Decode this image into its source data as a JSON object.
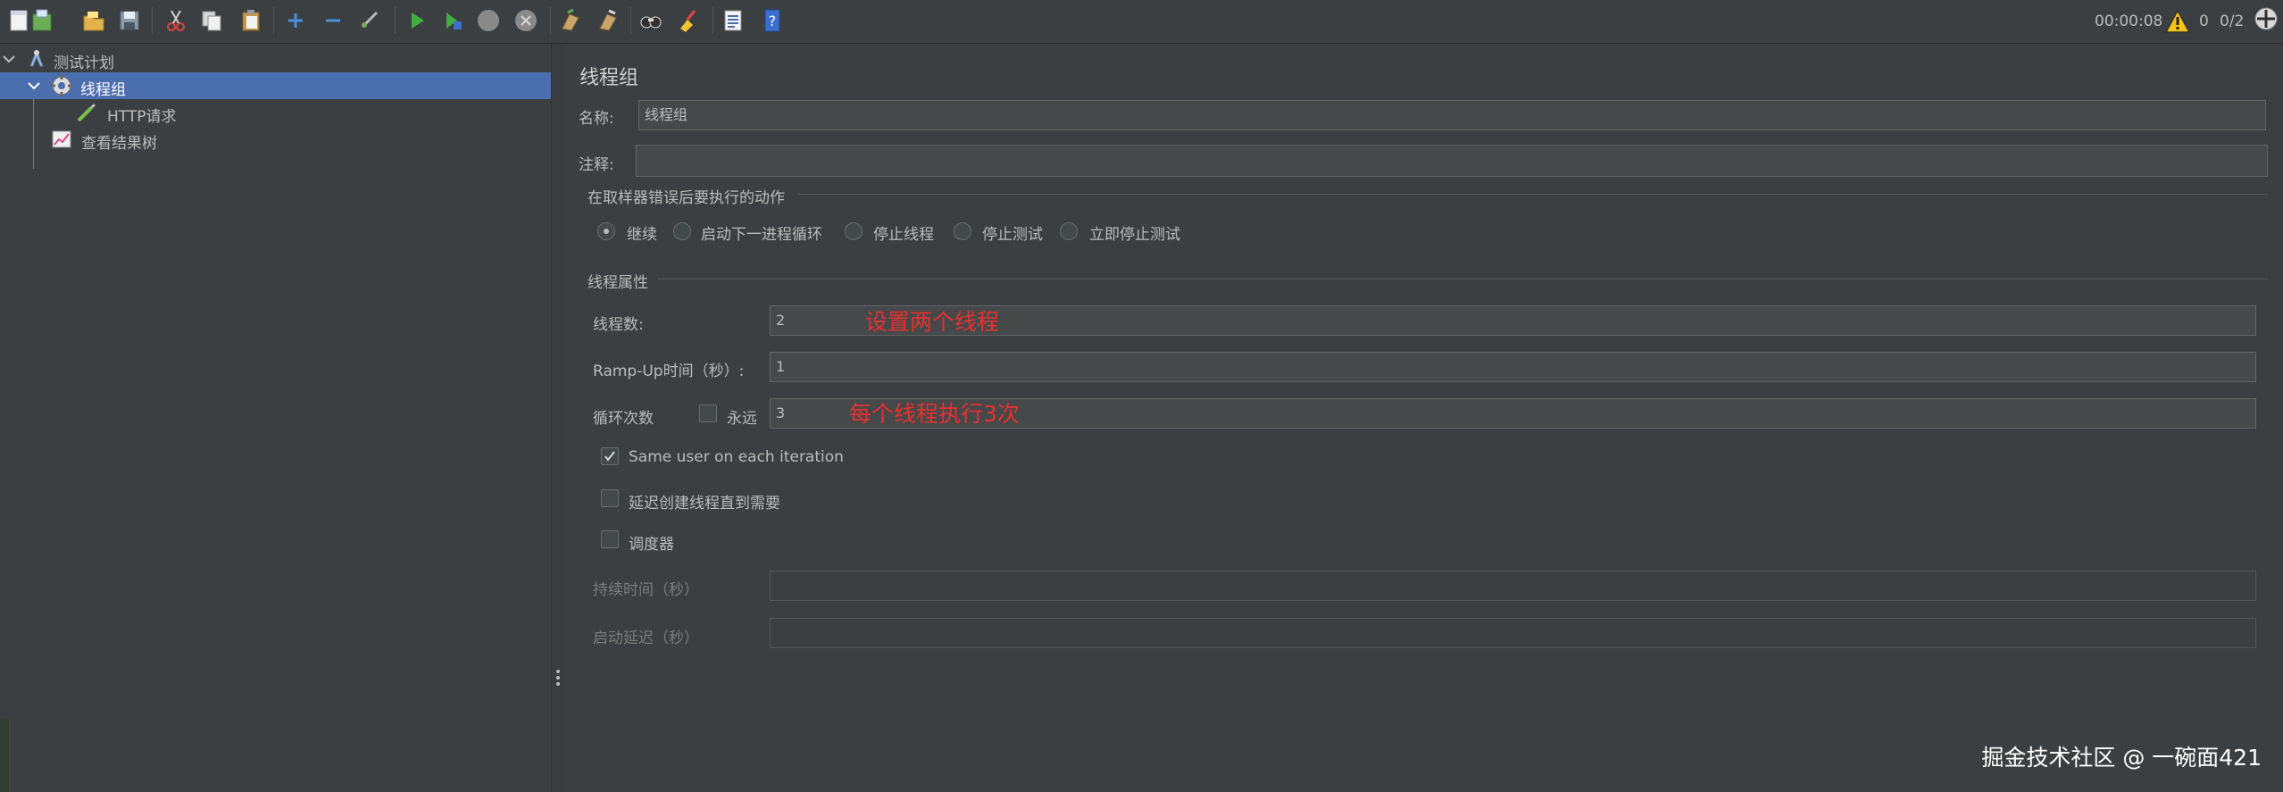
{
  "toolbar": {
    "buttons": [
      {
        "icon": "new-icon"
      },
      {
        "icon": "templates-icon"
      },
      {
        "icon": "open-icon"
      },
      {
        "icon": "save-icon"
      },
      {
        "icon": "cut-icon"
      },
      {
        "icon": "copy-icon"
      },
      {
        "icon": "paste-icon"
      },
      {
        "icon": "expand-all-icon"
      },
      {
        "icon": "collapse-all-icon"
      },
      {
        "icon": "toggle-icon"
      },
      {
        "icon": "start-icon"
      },
      {
        "icon": "start-no-pauses-icon"
      },
      {
        "icon": "stop-icon"
      },
      {
        "icon": "shutdown-icon"
      },
      {
        "icon": "clear-icon"
      },
      {
        "icon": "clear-all-icon"
      },
      {
        "icon": "search-icon"
      },
      {
        "icon": "reset-search-icon"
      },
      {
        "icon": "function-helper-icon"
      },
      {
        "icon": "help-icon"
      }
    ],
    "elapsed_time": "00:00:08",
    "warning_count": "0",
    "threads_status": "0/2"
  },
  "tree": {
    "items": [
      {
        "label": "测试计划",
        "icon": "test-plan-icon"
      },
      {
        "label": "线程组",
        "icon": "gear-icon"
      },
      {
        "label": "HTTP请求",
        "icon": "pipette-icon"
      },
      {
        "label": "查看结果树",
        "icon": "chart-icon"
      }
    ]
  },
  "panel": {
    "title": "线程组",
    "name_label": "名称:",
    "name_value": "线程组",
    "comment_label": "注释:",
    "comment_value": "",
    "error_group_title": "在取样器错误后要执行的动作",
    "error_options": [
      "继续",
      "启动下一进程循环",
      "停止线程",
      "停止测试",
      "立即停止测试"
    ],
    "error_selected": "继续",
    "thread_group_title": "线程属性",
    "threads_label": "线程数:",
    "threads_value": "2",
    "rampup_label": "Ramp-Up时间（秒）:",
    "rampup_value": "1",
    "loop_label": "循环次数",
    "forever_label": "永远",
    "forever_checked": false,
    "loop_value": "3",
    "same_user_label": "Same user on each iteration",
    "same_user_checked": true,
    "delay_create_label": "延迟创建线程直到需要",
    "delay_create_checked": false,
    "scheduler_label": "调度器",
    "scheduler_checked": false,
    "duration_label": "持续时间（秒）",
    "duration_value": "",
    "startup_delay_label": "启动延迟（秒）",
    "startup_delay_value": ""
  },
  "annotations": {
    "threads_note": "设置两个线程",
    "loop_note": "每个线程执行3次"
  },
  "watermark": "掘金技术社区 @ 一碗面421",
  "colors": {
    "background": "#3c3f41",
    "selection": "#4b6eaf",
    "annotation": "#ea2f2f",
    "field_bg": "#45494a"
  }
}
